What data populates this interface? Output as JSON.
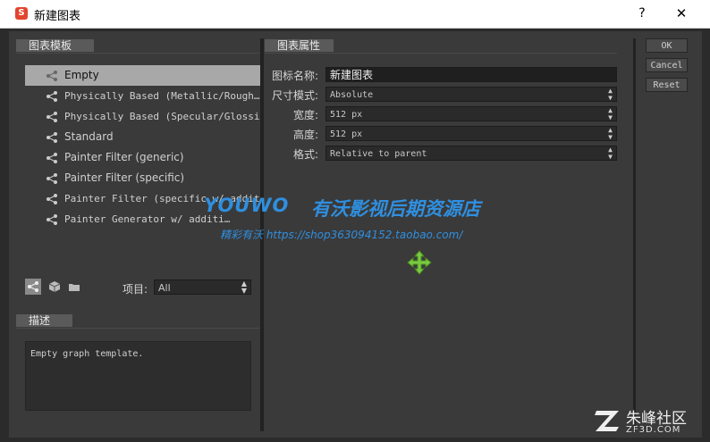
{
  "window": {
    "title": "新建图表",
    "help": "?",
    "close": "✕"
  },
  "templates_panel": {
    "header": "图表模板",
    "items": [
      {
        "label": "Empty",
        "selected": true
      },
      {
        "label": "Physically Based (Metallic/Rough…"
      },
      {
        "label": "Physically Based (Specular/Glossi…"
      },
      {
        "label": "Standard"
      },
      {
        "label": "Painter Filter (generic)"
      },
      {
        "label": "Painter Filter (specific)"
      },
      {
        "label": "Painter Filter (specific w/ additi…"
      },
      {
        "label": "Painter Generator w/ additi…"
      }
    ],
    "filter_label": "项目:",
    "filter_value": "All"
  },
  "description_panel": {
    "header": "描述",
    "text": "Empty graph template."
  },
  "properties_panel": {
    "header": "图表属性",
    "rows": [
      {
        "label": "图标名称:",
        "value": "新建图表"
      },
      {
        "label": "尺寸模式:",
        "value": "Absolute"
      },
      {
        "label": "宽度:",
        "value": "512 px"
      },
      {
        "label": "高度:",
        "value": "512 px"
      },
      {
        "label": "格式:",
        "value": "Relative to parent"
      }
    ]
  },
  "buttons": {
    "ok": "OK",
    "cancel": "Cancel",
    "reset": "Reset"
  },
  "watermark": {
    "brand": "YOUWO",
    "slogan": "有沃影视后期资源店",
    "sub": "精彩有沃 https://shop363094152.taobao.com/"
  },
  "corner": {
    "title": "朱峰社区",
    "sub": "ZF3D.COM"
  },
  "colors": {
    "accent_green": "#7ac943",
    "selection": "#a8a8a8",
    "watermark_blue": "#2f8fe0"
  }
}
